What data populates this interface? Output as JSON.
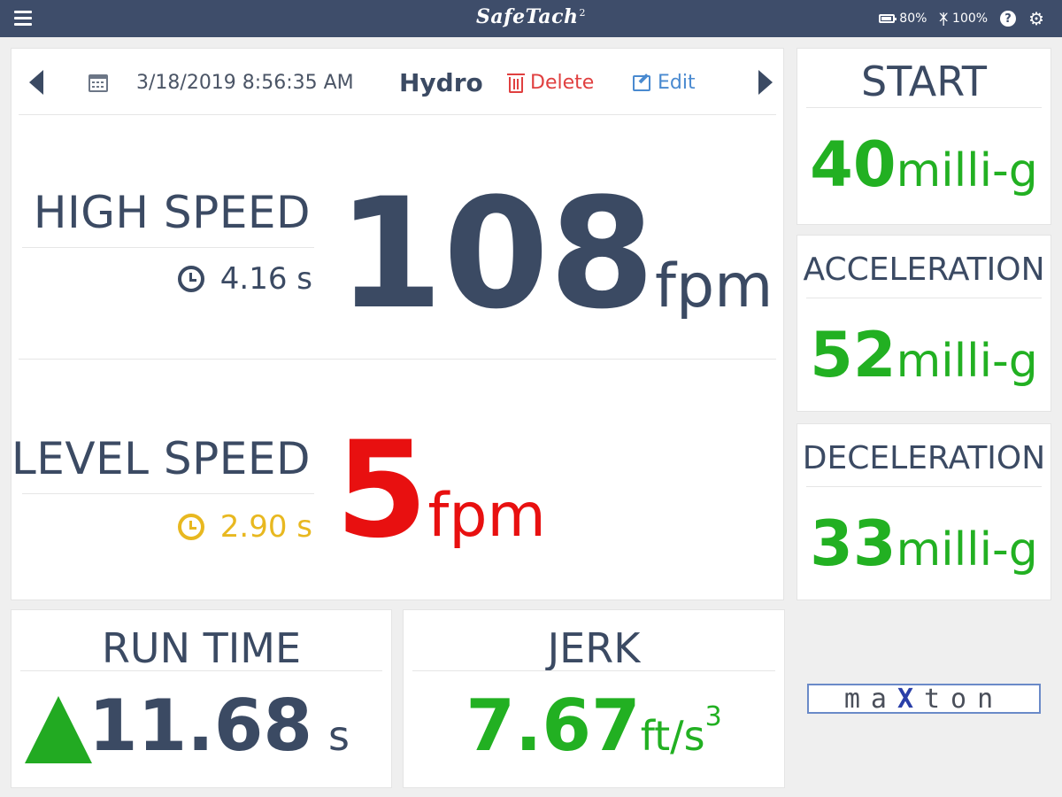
{
  "header": {
    "logo_text": "SafeTach",
    "logo_superscript": "2",
    "battery_label": "80%",
    "battery_level": 0.8,
    "bluetooth_label": "100%",
    "help_icon": "?",
    "menu_icon": "hamburger-icon",
    "settings_icon": "gear-icon"
  },
  "record_nav": {
    "date_time": "3/18/2019 8:56:35 AM",
    "type": "Hydro",
    "delete_label": "Delete",
    "edit_label": "Edit",
    "prev_icon": "arrow-left-icon",
    "next_icon": "arrow-right-icon",
    "calendar_icon": "calendar-icon"
  },
  "high_speed": {
    "label": "HIGH SPEED",
    "time": "4.16 s",
    "value": "108",
    "unit": "fpm",
    "value_color": "#3b4a63",
    "time_color": "#3b4a63"
  },
  "level_speed": {
    "label": "LEVEL SPEED",
    "time": "2.90 s",
    "value": "5",
    "unit": "fpm",
    "value_color": "#e81010",
    "time_color": "#e8b820"
  },
  "metrics": {
    "start": {
      "label": "START",
      "value": "40",
      "unit": "milli-g"
    },
    "acceleration": {
      "label": "ACCELERATION",
      "value": "52",
      "unit": "milli-g"
    },
    "deceleration": {
      "label": "DECELERATION",
      "value": "33",
      "unit": "milli-g"
    },
    "value_color": "#22b022"
  },
  "run_time": {
    "label": "RUN TIME",
    "value": "11.68",
    "unit": "s",
    "trend_icon": "arrow-up-icon",
    "trend_color": "#22aa22"
  },
  "jerk": {
    "label": "JERK",
    "value": "7.67",
    "unit": "ft/s",
    "unit_exponent": "3"
  },
  "brand": {
    "logo_pre": "ma",
    "logo_x": "X",
    "logo_post": "ton"
  }
}
